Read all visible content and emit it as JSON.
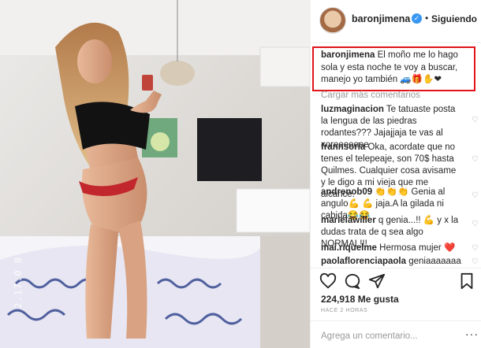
{
  "photo": {
    "watermark_text": "2.17.0 8"
  },
  "header": {
    "username": "baronjimena",
    "verified_icon": "verified-check-icon",
    "separator": "•",
    "follow_status": "Siguiendo"
  },
  "caption": {
    "username": "baronjimena",
    "text": " El moño me lo hago sola y esta noche te voy a buscar, manejo yo también 🚙🎁✋❤"
  },
  "load_more_label": "Cargar más comentarios",
  "comments": [
    {
      "user": "luzmaginacion",
      "text": " Te tatuaste posta la lengua de las piedras rodantes??? Jajajjaja te vas al xoreeeeeee"
    },
    {
      "user": "frannsoria",
      "text": " Oka, acordate que no tenes el telepeaje, son 70$ hasta Quilmes. Cualquier cosa avisame y le digo a mi vieja que me alcance."
    },
    {
      "user": "andrenob09",
      "text": " 👏👏👏 Genia al angulo💪 💪 jaja.A la gilada ni cabida😂😂"
    },
    {
      "user": "marielawiller",
      "text": " q genia...!! 💪 y x la dudas trata de q sea algo NORMAL!!!"
    },
    {
      "user": "mai.riquelme",
      "text": " Hermosa mujer ❤️"
    },
    {
      "user": "paolaflorenciapaola",
      "text": " geniaaaaaaa💕"
    }
  ],
  "actions": {
    "like_icon": "heart-outline-icon",
    "comment_icon": "comment-bubble-icon",
    "share_icon": "share-paper-plane-icon",
    "save_icon": "bookmark-icon"
  },
  "likes_text": "224,918 Me gusta",
  "time_ago": "HACE 2 HORAS",
  "comment_input": {
    "placeholder": "Agrega un comentario..."
  },
  "more_options": "···"
}
